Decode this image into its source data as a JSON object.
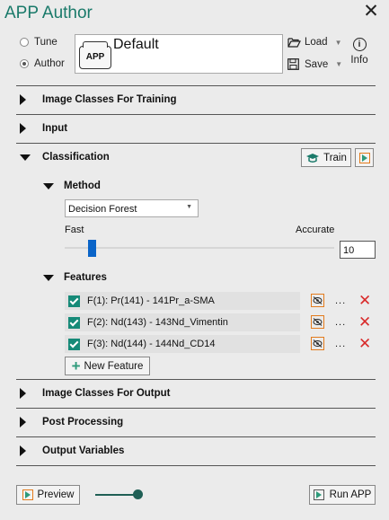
{
  "window": {
    "title": "APP Author"
  },
  "mode": {
    "tune_label": "Tune",
    "author_label": "Author",
    "selected": "Author"
  },
  "app": {
    "logo_text": "APP",
    "name": "Default"
  },
  "toolbar": {
    "load_label": "Load",
    "save_label": "Save",
    "info_label": "Info"
  },
  "sections": {
    "image_classes_training": "Image Classes For Training",
    "input": "Input",
    "classification": "Classification",
    "image_classes_output": "Image Classes For Output",
    "post_processing": "Post Processing",
    "output_variables": "Output Variables"
  },
  "classification": {
    "train_label": "Train",
    "method_label": "Method",
    "method_value": "Decision Forest",
    "speed_min_label": "Fast",
    "speed_max_label": "Accurate",
    "speed_value": "10",
    "speed_fraction": 0.1,
    "features_label": "Features",
    "features": [
      {
        "label": "F(1): Pr(141) - 141Pr_a-SMA",
        "checked": true
      },
      {
        "label": "F(2): Nd(143) - 143Nd_Vimentin",
        "checked": true
      },
      {
        "label": "F(3): Nd(144) - 144Nd_CD14",
        "checked": true
      }
    ],
    "new_feature_label": "New Feature",
    "more_label": "..."
  },
  "footer": {
    "preview_label": "Preview",
    "run_label": "Run APP",
    "preview_toggle_on": true
  },
  "colors": {
    "accent": "#1a7a6a",
    "orange": "#e37b1d",
    "check": "#168a78",
    "delete": "#d92b2b",
    "slider": "#0a64c8"
  }
}
